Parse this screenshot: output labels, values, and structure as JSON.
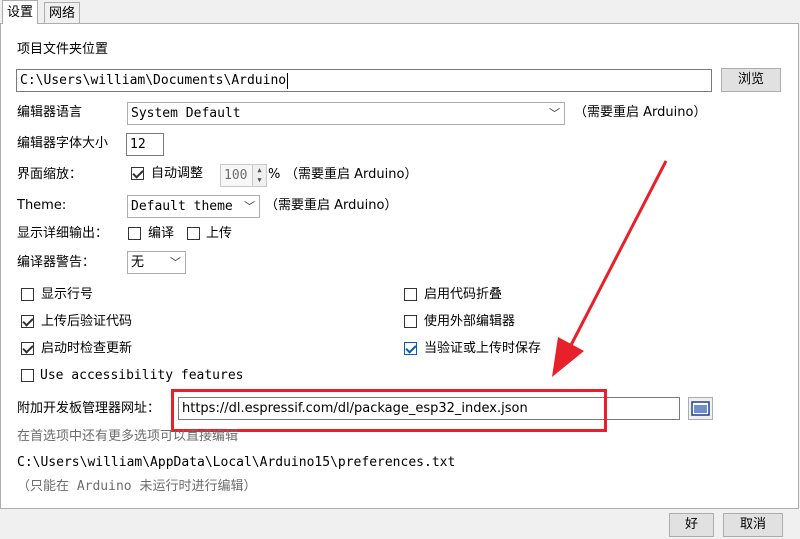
{
  "tabs": [
    {
      "label": "设置",
      "active": true
    },
    {
      "label": "网络",
      "active": false
    }
  ],
  "sketchbook": {
    "label": "项目文件夹位置",
    "value": "C:\\Users\\william\\Documents\\Arduino",
    "browse_label": "浏览"
  },
  "language": {
    "label": "编辑器语言",
    "value": "System Default",
    "note": "（需要重启 Arduino）"
  },
  "font_size": {
    "label": "编辑器字体大小",
    "value": "12"
  },
  "scaling": {
    "label": "界面缩放：",
    "auto_label": "自动调整",
    "auto_checked": true,
    "value": "100",
    "unit": "%",
    "note": "（需要重启 Arduino）"
  },
  "theme": {
    "label": "Theme:",
    "value": "Default theme",
    "note": "（需要重启 Arduino）"
  },
  "verbose": {
    "label": "显示详细输出：",
    "compile_label": "编译",
    "compile_checked": false,
    "upload_label": "上传",
    "upload_checked": false
  },
  "warnings": {
    "label": "编译器警告：",
    "value": "无"
  },
  "options_left": [
    {
      "label": "显示行号",
      "checked": false
    },
    {
      "label": "上传后验证代码",
      "checked": true
    },
    {
      "label": "启动时检查更新",
      "checked": true
    },
    {
      "label": "Use accessibility features",
      "checked": false
    }
  ],
  "options_right": [
    {
      "label": "启用代码折叠",
      "checked": false
    },
    {
      "label": "使用外部编辑器",
      "checked": false
    },
    {
      "label": "当验证或上传时保存",
      "checked": true
    }
  ],
  "board_urls": {
    "label": "附加开发板管理器网址：",
    "value": "https://dl.espressif.com/dl/package_esp32_index.json"
  },
  "more_prefs_note": "在首选项中还有更多选项可以直接编辑",
  "prefs_path": "C:\\Users\\william\\AppData\\Local\\Arduino15\\preferences.txt",
  "edit_note": "（只能在 Arduino 未运行时进行编辑）",
  "footer": {
    "ok_label": "好",
    "cancel_label": "取消"
  },
  "colors": {
    "highlight": "#e8202a",
    "checkbox_accent": "#005fb8"
  }
}
